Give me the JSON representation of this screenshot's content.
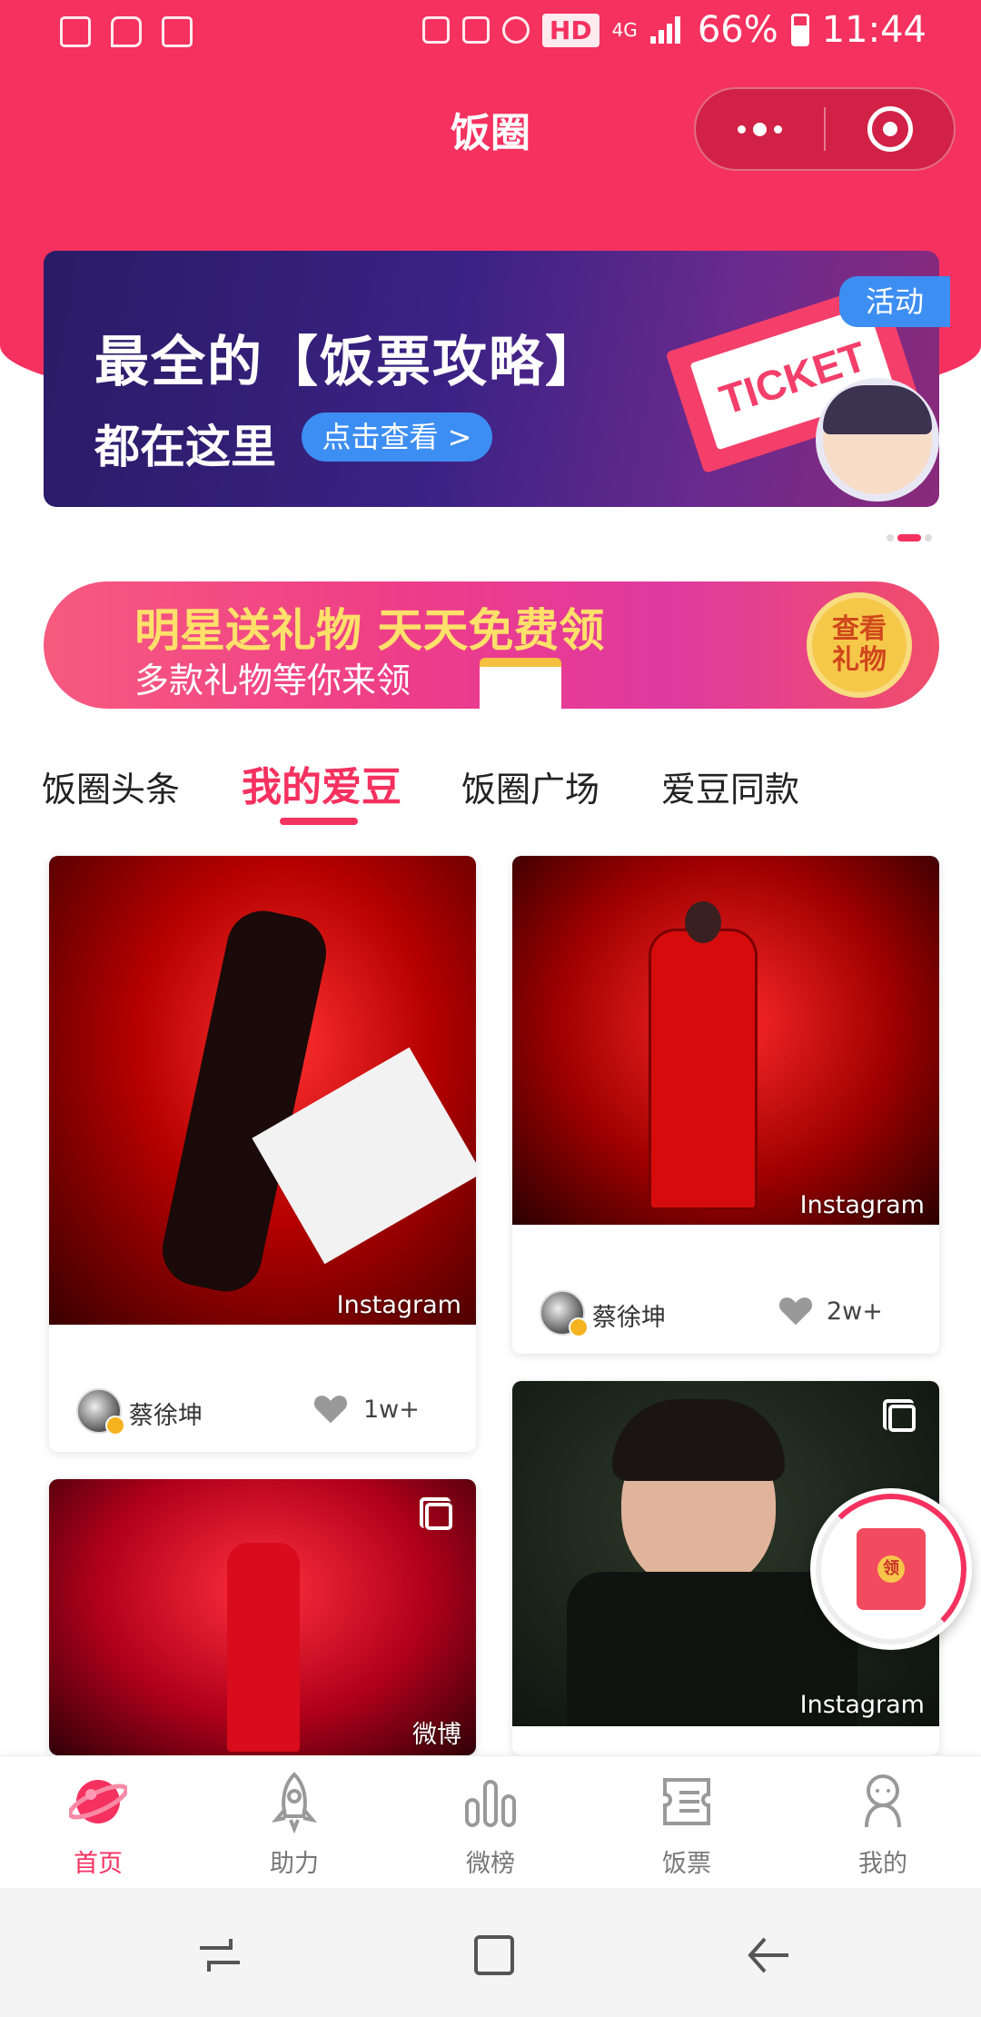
{
  "status_bar": {
    "network": "4G",
    "hd_badge": "HD",
    "battery": "66%",
    "time": "11:44"
  },
  "app": {
    "title": "饭圈"
  },
  "banner": {
    "headline": "最全的【饭票攻略】",
    "subline": "都在这里",
    "button_label": "点击查看 >",
    "ticket_text": "TICKET",
    "tag": "活动"
  },
  "gift_banner": {
    "headline": "明星送礼物  天天免费领",
    "subline": "多款礼物等你来领",
    "badge": "查看\n礼物"
  },
  "tabs": [
    {
      "label": "饭圈头条",
      "active": false
    },
    {
      "label": "我的爱豆",
      "active": true
    },
    {
      "label": "饭圈广场",
      "active": false
    },
    {
      "label": "爱豆同款",
      "active": false
    }
  ],
  "feed": [
    {
      "source": "Instagram",
      "author": "蔡徐坤",
      "likes": "1w+"
    },
    {
      "source": "Instagram",
      "author": "蔡徐坤",
      "likes": "2w+"
    },
    {
      "source": "微博",
      "author": "",
      "likes": ""
    },
    {
      "source": "Instagram",
      "author": "",
      "likes": ""
    }
  ],
  "red_packet": {
    "label": "领"
  },
  "bottom_nav": [
    {
      "label": "首页",
      "icon": "planet-icon",
      "active": true
    },
    {
      "label": "助力",
      "icon": "rocket-icon",
      "active": false
    },
    {
      "label": "微榜",
      "icon": "bar-chart-icon",
      "active": false
    },
    {
      "label": "饭票",
      "icon": "ticket-list-icon",
      "active": false
    },
    {
      "label": "我的",
      "icon": "person-icon",
      "active": false
    }
  ],
  "colors": {
    "primary": "#f5315f",
    "accent_blue": "#3d8ef3",
    "gift_yellow": "#ffe06a"
  }
}
